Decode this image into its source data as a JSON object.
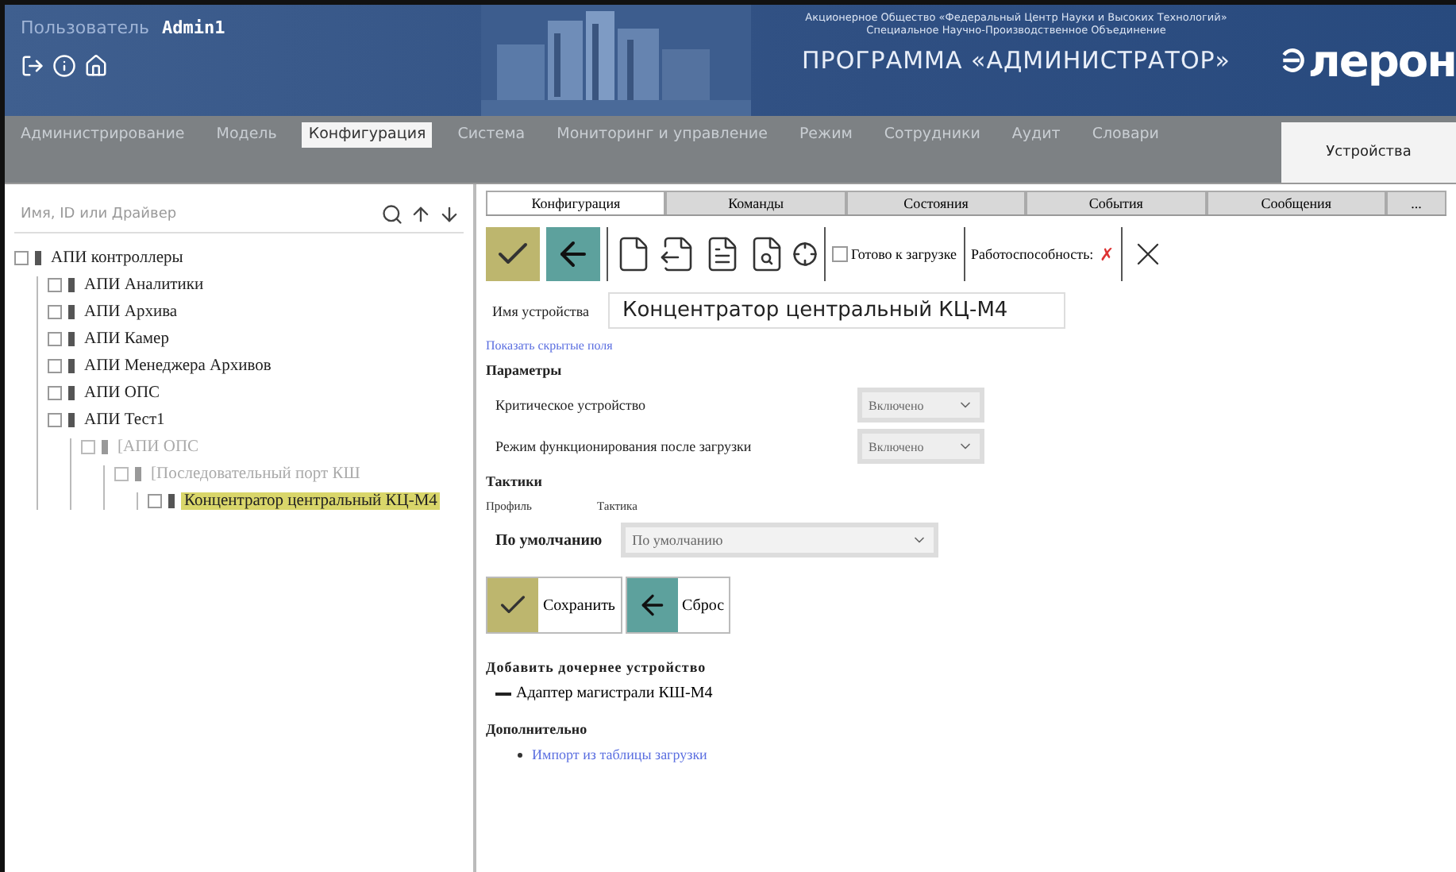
{
  "header": {
    "user_label": "Пользователь",
    "user_name": "Admin1",
    "org_line_1": "Акционерное Общество «Федеральный Центр Науки и Высоких Технологий»",
    "org_line_2": "Специальное Научно-Производственное Объединение",
    "program_title": "ПРОГРАММА «АДМИНИСТРАТОР»",
    "logo_text": "лерон"
  },
  "nav": {
    "items": [
      {
        "label": "Администрирование",
        "selected": false
      },
      {
        "label": "Модель",
        "selected": false
      },
      {
        "label": "Конфигурация",
        "selected": true
      },
      {
        "label": "Система",
        "selected": false
      },
      {
        "label": "Мониторинг и управление",
        "selected": false
      },
      {
        "label": "Режим",
        "selected": false
      },
      {
        "label": "Сотрудники",
        "selected": false
      },
      {
        "label": "Аудит",
        "selected": false
      },
      {
        "label": "Словари",
        "selected": false
      }
    ],
    "side_tab": "Устройства"
  },
  "sidebar": {
    "search": {
      "placeholder": "Имя, ID или Драйвер"
    },
    "tree": [
      {
        "label": "АПИ контроллеры",
        "selected": false,
        "disabled": false,
        "children": [
          {
            "label": "АПИ Аналитики",
            "selected": false,
            "disabled": false
          },
          {
            "label": "АПИ Архива",
            "selected": false,
            "disabled": false
          },
          {
            "label": "АПИ Камер",
            "selected": false,
            "disabled": false
          },
          {
            "label": "АПИ Менеджера Архивов",
            "selected": false,
            "disabled": false
          },
          {
            "label": "АПИ ОПС",
            "selected": false,
            "disabled": false
          },
          {
            "label": "АПИ Тест1",
            "selected": false,
            "disabled": false,
            "children": [
              {
                "label": "[АПИ ОПС",
                "selected": false,
                "disabled": true,
                "children": [
                  {
                    "label": "[Последовательный порт КШ",
                    "selected": false,
                    "disabled": true,
                    "children": [
                      {
                        "label": "Концентратор центральный КЦ-М4",
                        "selected": true,
                        "disabled": false
                      }
                    ]
                  }
                ]
              }
            ]
          }
        ]
      }
    ]
  },
  "main": {
    "tabs": [
      {
        "label": "Конфигурация",
        "selected": true
      },
      {
        "label": "Команды",
        "selected": false
      },
      {
        "label": "Состояния",
        "selected": false
      },
      {
        "label": "События",
        "selected": false
      },
      {
        "label": "Сообщения",
        "selected": false
      },
      {
        "label": "...",
        "selected": false
      }
    ],
    "toolbar": {
      "ready_label": "Готово к загрузке",
      "ready_checked": false,
      "health_label": "Работоспособность:",
      "health_mark": "✗"
    },
    "device_name": {
      "label": "Имя устройства",
      "value": "Концентратор центральный КЦ-М4"
    },
    "show_hidden_link": "Показать скрытые поля",
    "params_title": "Параметры",
    "params": [
      {
        "label": "Критическое устройство",
        "value": "Включено"
      },
      {
        "label": "Режим функционирования после загрузки",
        "value": "Включено"
      }
    ],
    "tactics": {
      "title": "Тактики",
      "col_profile": "Профиль",
      "col_tactic": "Тактика",
      "profile": "По умолчанию",
      "tactic": "По умолчанию"
    },
    "buttons": {
      "save": "Сохранить",
      "reset": "Сброс"
    },
    "add_child_title": "Добавить дочернее устройство",
    "child_devices": [
      "Адаптер магистрали КШ-М4"
    ],
    "extra_title": "Дополнительно",
    "extra_links": [
      "Импорт из таблицы загрузки"
    ]
  }
}
